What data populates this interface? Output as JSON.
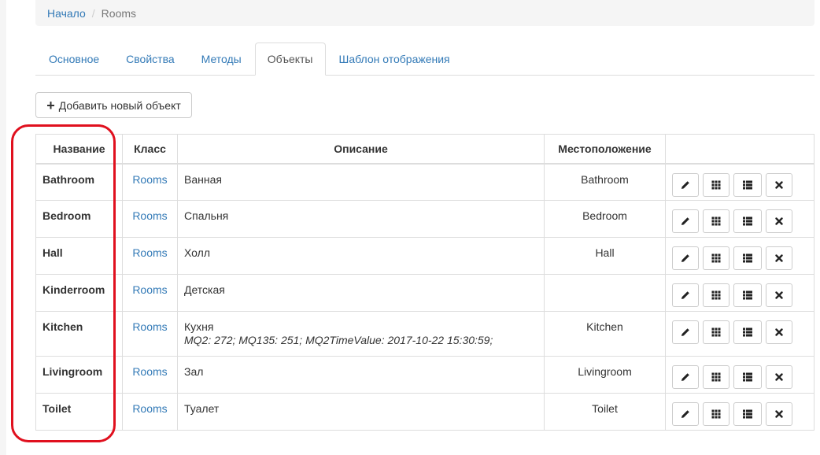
{
  "breadcrumb": {
    "home": "Начало",
    "separator": "/",
    "current": "Rooms"
  },
  "tabs": [
    {
      "label": "Основное"
    },
    {
      "label": "Свойства"
    },
    {
      "label": "Методы"
    },
    {
      "label": "Объекты",
      "active": true
    },
    {
      "label": "Шаблон отображения"
    }
  ],
  "toolbar": {
    "add_label": "Добавить новый объект",
    "add_icon": "plus-icon"
  },
  "table": {
    "headers": {
      "name": "Название",
      "class": "Класс",
      "description": "Описание",
      "location": "Местоположение",
      "actions": ""
    },
    "rows": [
      {
        "name": "Bathroom",
        "class": "Rooms",
        "description": "Ванная",
        "extra": "",
        "location": "Bathroom"
      },
      {
        "name": "Bedroom",
        "class": "Rooms",
        "description": "Спальня",
        "extra": "",
        "location": "Bedroom"
      },
      {
        "name": "Hall",
        "class": "Rooms",
        "description": "Холл",
        "extra": "",
        "location": "Hall"
      },
      {
        "name": "Kinderroom",
        "class": "Rooms",
        "description": "Детская",
        "extra": "",
        "location": ""
      },
      {
        "name": "Kitchen",
        "class": "Rooms",
        "description": "Кухня",
        "extra": "MQ2: 272; MQ135: 251; MQ2TimeValue: 2017-10-22 15:30:59;",
        "location": "Kitchen"
      },
      {
        "name": "Livingroom",
        "class": "Rooms",
        "description": "Зал",
        "extra": "",
        "location": "Livingroom"
      },
      {
        "name": "Toilet",
        "class": "Rooms",
        "description": "Туалет",
        "extra": "",
        "location": "Toilet"
      }
    ],
    "row_actions": [
      "pencil-icon",
      "grid-icon",
      "list-icon",
      "close-icon"
    ]
  },
  "colors": {
    "link": "#337ab7",
    "highlight": "#e0101e",
    "border": "#dddddd"
  }
}
